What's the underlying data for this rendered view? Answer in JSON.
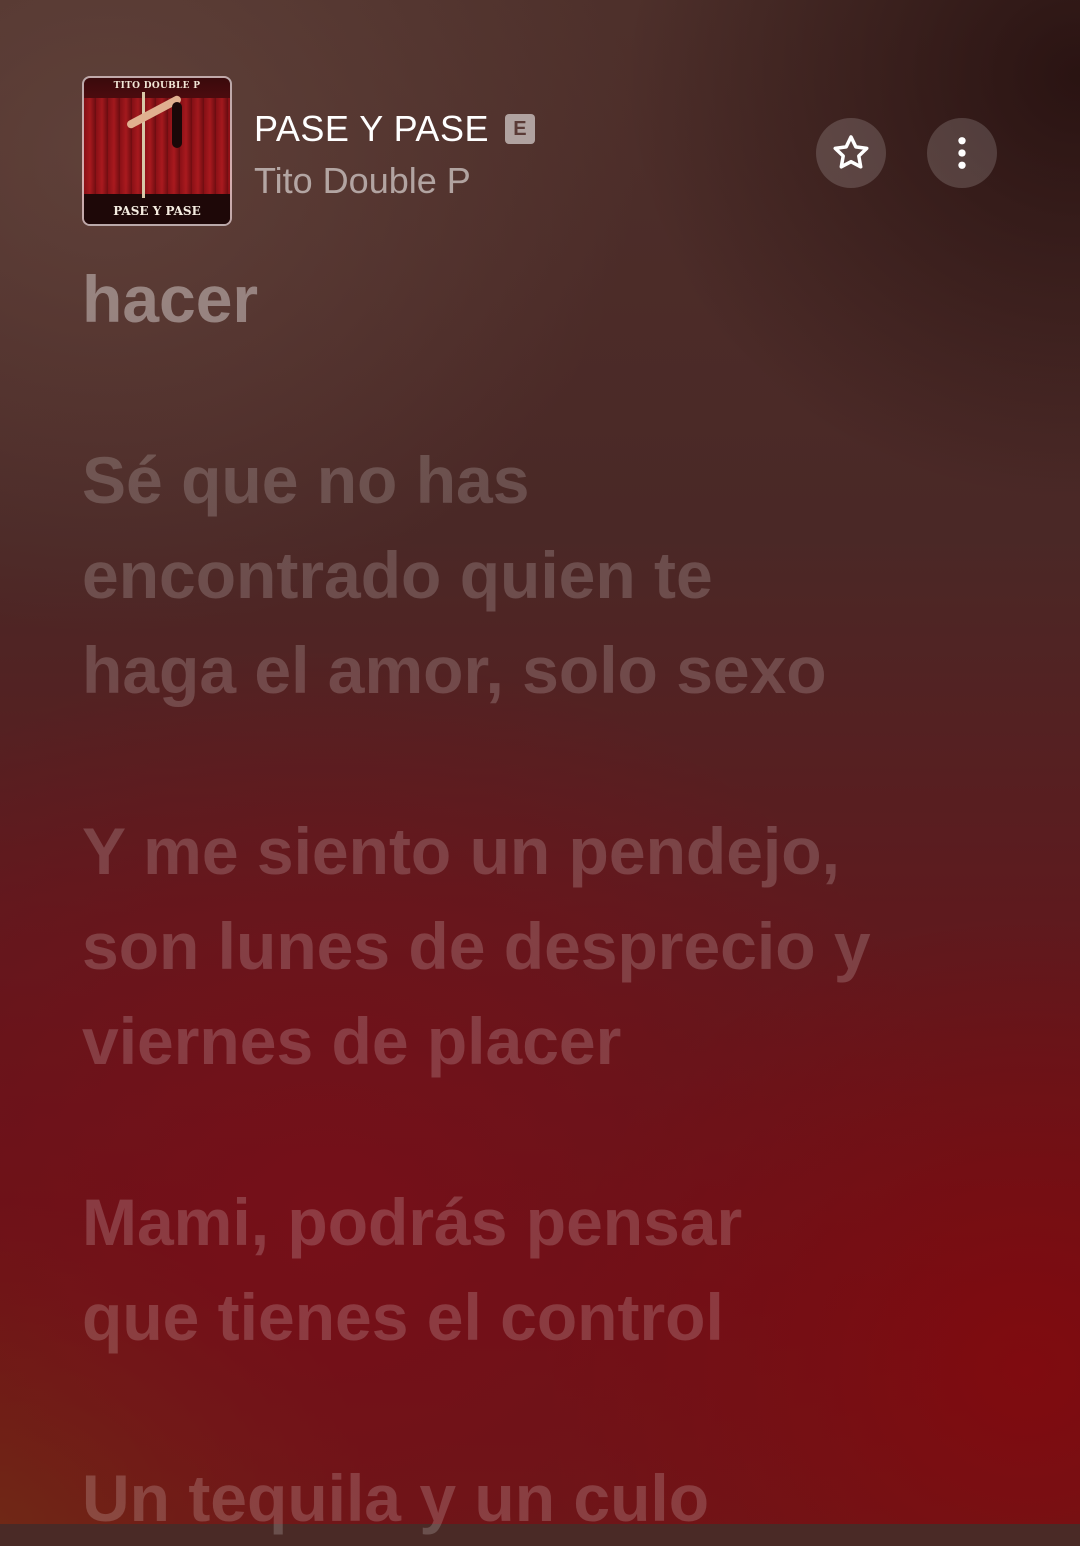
{
  "now_playing": {
    "title": "PASE Y PASE",
    "explicit_badge": "E",
    "artist": "Tito Double P",
    "artwork": {
      "top_text": "TITO DOUBLE P",
      "bottom_text": "PASE Y PASE"
    }
  },
  "actions": {
    "star_icon": "star-outline-icon",
    "more_icon": "more-vertical-icon"
  },
  "lyrics": {
    "previous_line": "hacer",
    "stanzas": [
      [
        "Sé que no has",
        "encontrado quien te",
        "haga el amor, solo sexo"
      ],
      [
        "Y me siento un pendejo,",
        "son lunes de desprecio y",
        "viernes de placer"
      ],
      [
        "Mami, podrás pensar",
        "que tienes el control"
      ],
      [
        "Un tequila y un culo"
      ]
    ]
  },
  "colors": {
    "background_top": "#4e302b",
    "background_bottom": "#6a1116",
    "lyric_dim": "rgba(255,255,255,0.18)",
    "title_text": "#ffffff"
  }
}
